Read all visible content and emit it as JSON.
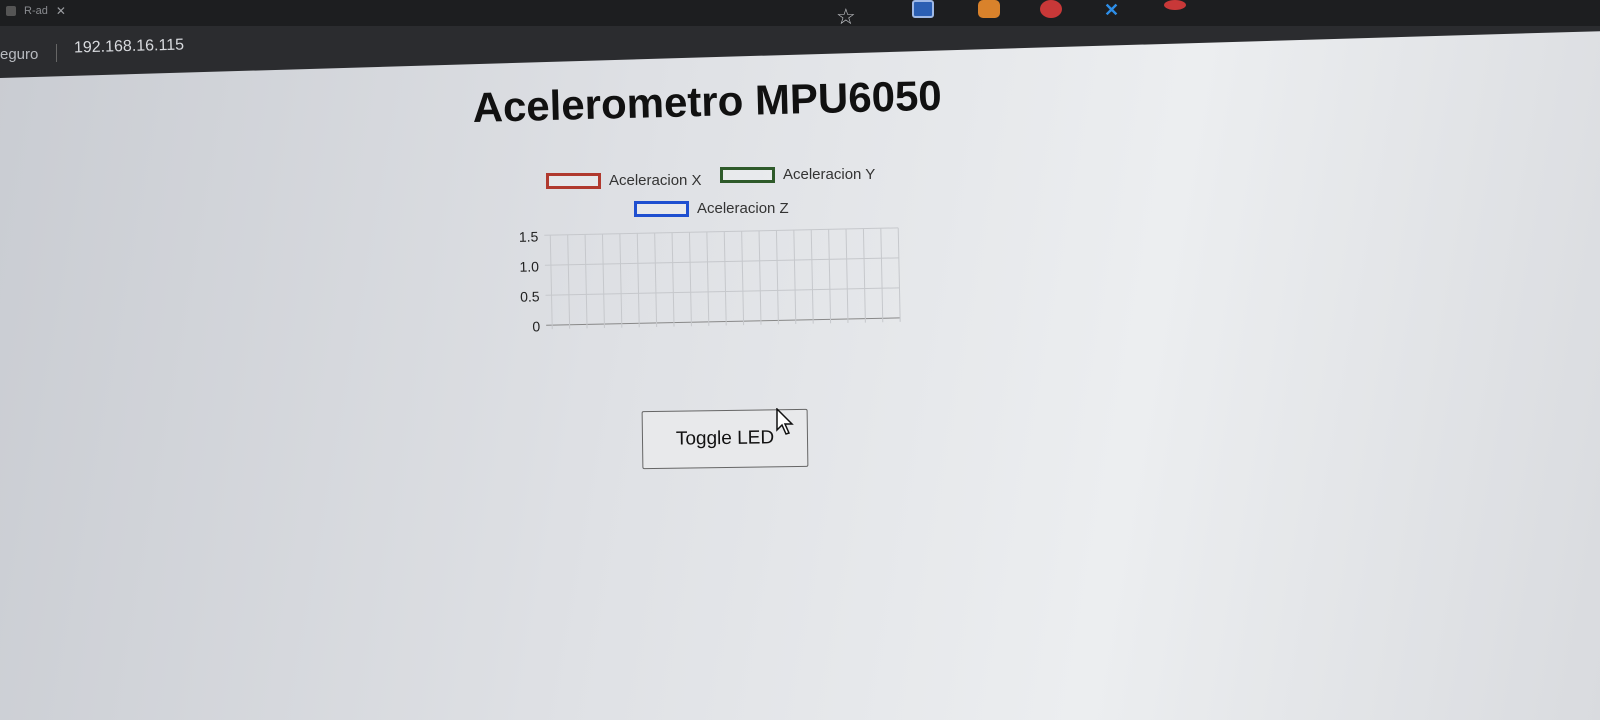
{
  "browser": {
    "tab_title": "R-ad",
    "secure_label": "eguro",
    "url": "192.168.16.115"
  },
  "page": {
    "title": "Acelerometro MPU6050",
    "toggle_button": "Toggle LED"
  },
  "colors": {
    "accel_x": "#b0392e",
    "accel_y": "#2e5a2a",
    "accel_z": "#1f4fd0"
  },
  "chart_data": {
    "type": "line",
    "series": [
      {
        "name": "Aceleracion X",
        "color": "#b0392e",
        "values": []
      },
      {
        "name": "Aceleracion Y",
        "color": "#2e5a2a",
        "values": []
      },
      {
        "name": "Aceleracion Z",
        "color": "#1f4fd0",
        "values": []
      }
    ],
    "yticks": [
      "1.5",
      "1.0",
      "0.5",
      "0"
    ],
    "ylim": [
      0,
      1.5
    ],
    "x_gridlines": 20,
    "grid": true,
    "legend": "top"
  }
}
